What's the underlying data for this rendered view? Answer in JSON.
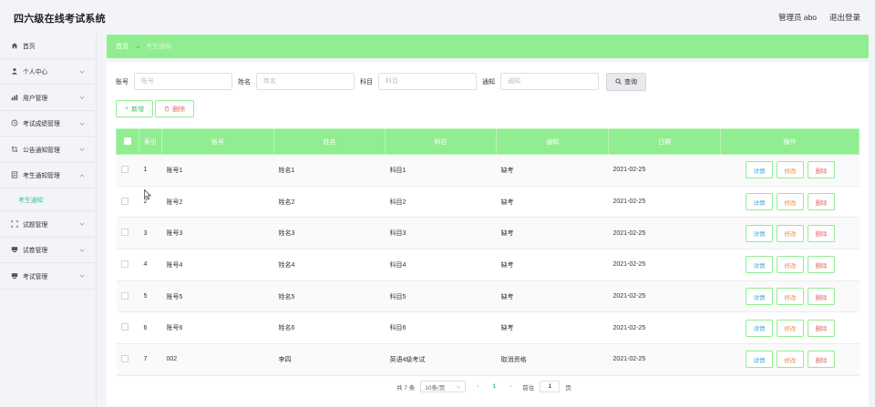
{
  "header": {
    "title": "四六级在线考试系统",
    "role": "管理员 abo",
    "logout": "退出登录"
  },
  "sidebar": {
    "items": [
      {
        "label": "首页",
        "icon": "home-icon",
        "chevron": false
      },
      {
        "label": "个人中心",
        "icon": "user-icon",
        "chevron": true
      },
      {
        "label": "用户管理",
        "icon": "chart-icon",
        "chevron": true
      },
      {
        "label": "考试成绩管理",
        "icon": "clock-icon",
        "chevron": true
      },
      {
        "label": "公告通知管理",
        "icon": "crop-icon",
        "chevron": true
      },
      {
        "label": "考生通知管理",
        "icon": "doc-icon",
        "chevron": true,
        "expanded": true
      }
    ],
    "submenu": {
      "label": "考生通知"
    },
    "items_after": [
      {
        "label": "试题管理",
        "icon": "scan-icon"
      },
      {
        "label": "试卷管理",
        "icon": "monitor-icon"
      },
      {
        "label": "考试管理",
        "icon": "monitor-icon"
      }
    ]
  },
  "breadcrumb": {
    "home": "首页",
    "separator": "→",
    "current": "考生通知"
  },
  "search": {
    "account_label": "账号",
    "account_placeholder": "账号",
    "name_label": "姓名",
    "name_placeholder": "姓名",
    "subject_label": "科目",
    "subject_placeholder": "科目",
    "notice_label": "通知",
    "notice_placeholder": "通知",
    "query_button": "查询"
  },
  "actions": {
    "add": "新增",
    "delete": "删除"
  },
  "table": {
    "headers": [
      "索引",
      "账号",
      "姓名",
      "科目",
      "通知",
      "日期",
      "操作"
    ],
    "rows": [
      {
        "index": "1",
        "account": "账号1",
        "name": "姓名1",
        "subject": "科目1",
        "notice": "缺考",
        "date": "2021-02-25"
      },
      {
        "index": "2",
        "account": "账号2",
        "name": "姓名2",
        "subject": "科目2",
        "notice": "缺考",
        "date": "2021-02-25"
      },
      {
        "index": "3",
        "account": "账号3",
        "name": "姓名3",
        "subject": "科目3",
        "notice": "缺考",
        "date": "2021-02-25"
      },
      {
        "index": "4",
        "account": "账号4",
        "name": "姓名4",
        "subject": "科目4",
        "notice": "缺考",
        "date": "2021-02-25"
      },
      {
        "index": "5",
        "account": "账号5",
        "name": "姓名5",
        "subject": "科目5",
        "notice": "缺考",
        "date": "2021-02-25"
      },
      {
        "index": "6",
        "account": "账号6",
        "name": "姓名6",
        "subject": "科目6",
        "notice": "缺考",
        "date": "2021-02-25"
      },
      {
        "index": "7",
        "account": "002",
        "name": "李四",
        "subject": "英语4级考试",
        "notice": "取消资格",
        "date": "2021-02-25"
      }
    ],
    "row_actions": {
      "detail": "详情",
      "edit": "修改",
      "remove": "删除"
    }
  },
  "pagination": {
    "total": "共 7 条",
    "page_size": "10条/页",
    "prev": "‹",
    "current": "1",
    "next": "›",
    "goto_label": "前往",
    "goto_value": "1",
    "page_suffix": "页"
  },
  "colors": {
    "accent": "#90ee90",
    "active_text": "#3fbf8a"
  }
}
